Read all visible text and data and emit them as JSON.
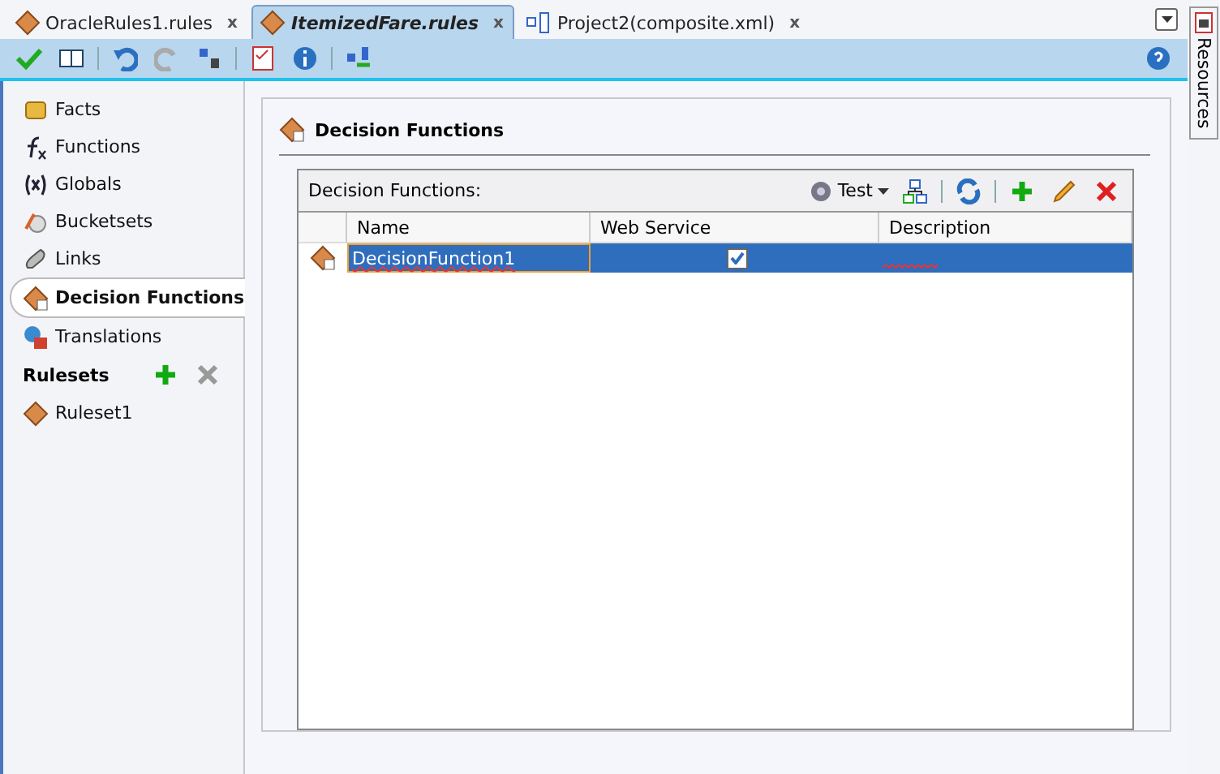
{
  "editor_tabs": [
    {
      "label": "OracleRules1.rules",
      "selected": false,
      "kind": "rules",
      "close": "x"
    },
    {
      "label": "ItemizedFare.rules",
      "selected": true,
      "kind": "rules",
      "close": "x"
    },
    {
      "label": "Project2(composite.xml)",
      "selected": false,
      "kind": "composite",
      "close": "x"
    }
  ],
  "side_panel": {
    "label": "Resources"
  },
  "sidebar": {
    "items": [
      {
        "label": "Facts",
        "kind": "facts",
        "selected": false
      },
      {
        "label": "Functions",
        "kind": "functions",
        "selected": false
      },
      {
        "label": "Globals",
        "kind": "globals",
        "selected": false
      },
      {
        "label": "Bucketsets",
        "kind": "bucketsets",
        "selected": false
      },
      {
        "label": "Links",
        "kind": "links",
        "selected": false
      },
      {
        "label": "Decision Functions",
        "kind": "decision",
        "selected": true
      },
      {
        "label": "Translations",
        "kind": "translations",
        "selected": false
      }
    ],
    "rulesets_heading": "Rulesets",
    "rulesets": [
      {
        "label": "Ruleset1",
        "selected": false
      }
    ]
  },
  "content": {
    "title": "Decision Functions",
    "table": {
      "caption": "Decision Functions:",
      "test_label": "Test",
      "columns": [
        "Name",
        "Web Service",
        "Description"
      ],
      "rows": [
        {
          "name": "DecisionFunction1",
          "web_service": true,
          "selected": true
        }
      ]
    }
  }
}
